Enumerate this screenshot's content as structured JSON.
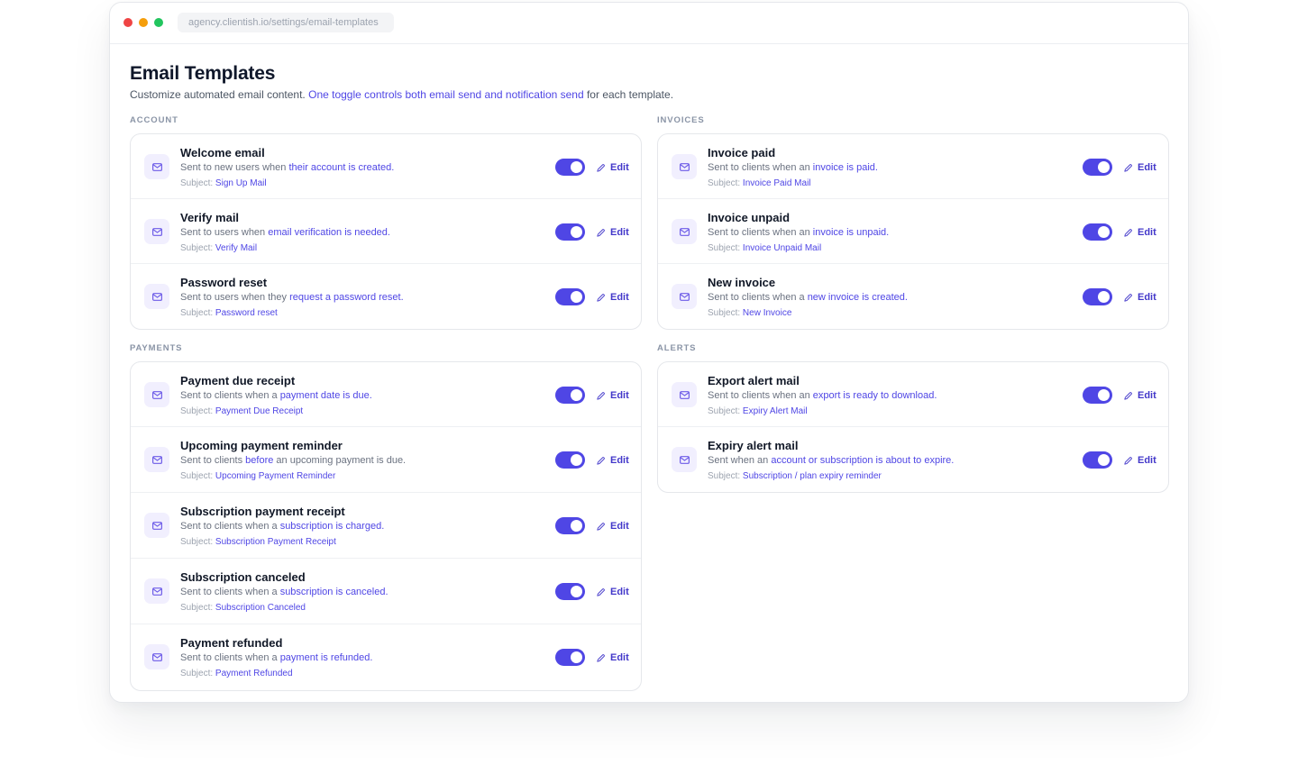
{
  "browser": {
    "url": "agency.clientish.io/settings/email-templates"
  },
  "page": {
    "title": "Email Templates",
    "desc_prefix": "Customize automated email content. ",
    "desc_highlight": "One toggle controls both email send and notification send",
    "desc_suffix": " for each template."
  },
  "labels": {
    "subject_label": "Subject: ",
    "edit_label": "Edit"
  },
  "colors": {
    "accent": "#4f46e5",
    "icon_bg": "#f1effe",
    "traffic_red": "#ef4444",
    "traffic_yellow": "#f59e0b",
    "traffic_green": "#22c55e"
  },
  "icons": {
    "template": "mail-icon",
    "edit": "pencil-icon"
  },
  "sections": {
    "account": {
      "title": "ACCOUNT",
      "items": [
        {
          "name": "Welcome email",
          "desc_a": "Sent to new users when ",
          "desc_b": "their account is created.",
          "desc_c": "",
          "subject": "Sign Up Mail",
          "enabled": true
        },
        {
          "name": "Verify mail",
          "desc_a": "Sent to users when ",
          "desc_b": "email verification is needed.",
          "desc_c": "",
          "subject": "Verify Mail",
          "enabled": true
        },
        {
          "name": "Password reset",
          "desc_a": "Sent to users when they ",
          "desc_b": "request a password reset.",
          "desc_c": "",
          "subject": "Password reset",
          "enabled": true
        }
      ]
    },
    "invoices": {
      "title": "INVOICES",
      "items": [
        {
          "name": "Invoice paid",
          "desc_a": "Sent to clients when an ",
          "desc_b": "invoice is paid.",
          "desc_c": "",
          "subject": "Invoice Paid Mail",
          "enabled": true
        },
        {
          "name": "Invoice unpaid",
          "desc_a": "Sent to clients when an ",
          "desc_b": "invoice is unpaid.",
          "desc_c": "",
          "subject": "Invoice Unpaid Mail",
          "enabled": true
        },
        {
          "name": "New invoice",
          "desc_a": "Sent to clients when a ",
          "desc_b": "new invoice is created.",
          "desc_c": "",
          "subject": "New Invoice",
          "enabled": true
        }
      ]
    },
    "payments": {
      "title": "PAYMENTS",
      "items": [
        {
          "name": "Payment due receipt",
          "desc_a": "Sent to clients when a ",
          "desc_b": "payment date is due.",
          "desc_c": "",
          "subject": "Payment Due Receipt",
          "enabled": true
        },
        {
          "name": "Upcoming payment reminder",
          "desc_a": "Sent to clients ",
          "desc_b": "before",
          "desc_c": " an upcoming payment is due.",
          "subject": "Upcoming Payment Reminder",
          "enabled": true
        },
        {
          "name": "Subscription payment receipt",
          "desc_a": "Sent to clients when a ",
          "desc_b": "subscription is charged.",
          "desc_c": "",
          "subject": "Subscription Payment Receipt",
          "enabled": true
        },
        {
          "name": "Subscription canceled",
          "desc_a": "Sent to clients when a ",
          "desc_b": "subscription is canceled.",
          "desc_c": "",
          "subject": "Subscription Canceled",
          "enabled": true
        },
        {
          "name": "Payment refunded",
          "desc_a": "Sent to clients when a ",
          "desc_b": "payment is refunded.",
          "desc_c": "",
          "subject": "Payment Refunded",
          "enabled": true
        }
      ]
    },
    "alerts": {
      "title": "ALERTS",
      "items": [
        {
          "name": "Export alert mail",
          "desc_a": "Sent to clients when an ",
          "desc_b": "export is ready to download.",
          "desc_c": "",
          "subject": "Expiry Alert Mail",
          "enabled": true
        },
        {
          "name": "Expiry alert mail",
          "desc_a": "Sent when an ",
          "desc_b": "account or subscription is about to expire.",
          "desc_c": "",
          "subject": "Subscription / plan expiry reminder",
          "enabled": true
        }
      ]
    }
  }
}
